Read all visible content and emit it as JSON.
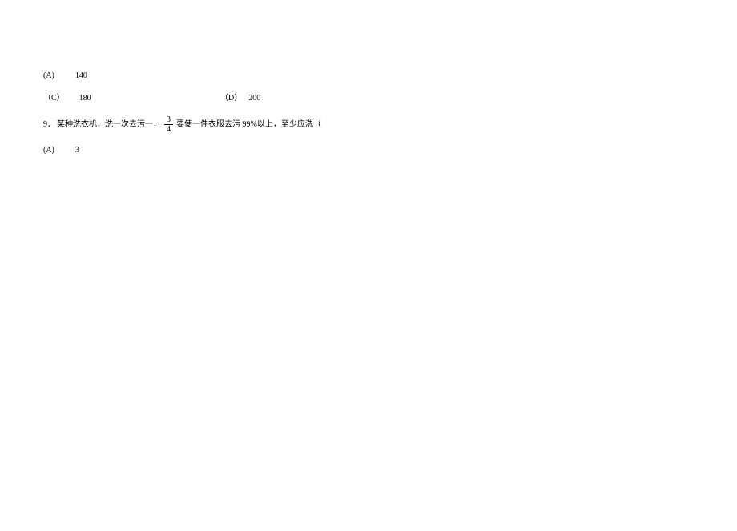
{
  "options_prev": {
    "A": {
      "label": "(A)",
      "value": "140"
    },
    "C": {
      "label": "（C）",
      "value": "180"
    },
    "D": {
      "label": "（D）",
      "value": "200"
    }
  },
  "question9": {
    "number": "9．",
    "text_before_fraction": "某种洗衣机，洗一次去污一，",
    "fraction": {
      "numerator": "3",
      "denominator": "4"
    },
    "text_after_fraction": "要使一件衣服去污 99%以上，至少应洗（"
  },
  "options_q9": {
    "A": {
      "label": "(A)",
      "value": "3"
    }
  }
}
